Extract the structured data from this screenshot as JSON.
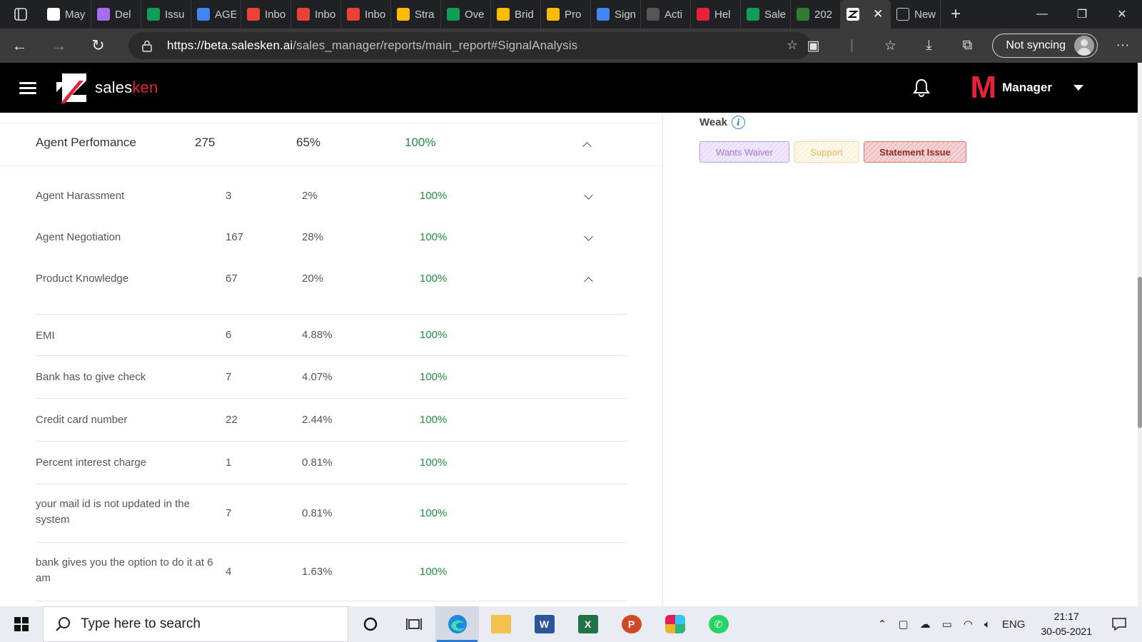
{
  "browser": {
    "tabs": [
      {
        "title": "May",
        "icon": "maps-pin-icon",
        "color": "#ffffff"
      },
      {
        "title": "Del",
        "icon": "app-icon",
        "color": "#a76cf0"
      },
      {
        "title": "Issu",
        "icon": "sheets-icon",
        "color": "#0f9d58"
      },
      {
        "title": "AGE",
        "icon": "docs-icon",
        "color": "#4285f4"
      },
      {
        "title": "Inbo",
        "icon": "gmail-icon",
        "color": "#ea4335"
      },
      {
        "title": "Inbo",
        "icon": "gmail-icon",
        "color": "#ea4335"
      },
      {
        "title": "Inbo",
        "icon": "gmail-icon",
        "color": "#ea4335"
      },
      {
        "title": "Stra",
        "icon": "drive-icon",
        "color": "#fbbc04"
      },
      {
        "title": "Ove",
        "icon": "sheets-icon",
        "color": "#0f9d58"
      },
      {
        "title": "Brid",
        "icon": "drive-icon",
        "color": "#fbbc04"
      },
      {
        "title": "Pro",
        "icon": "drive-icon",
        "color": "#fbbc04"
      },
      {
        "title": "Sign",
        "icon": "docs-icon",
        "color": "#4285f4"
      },
      {
        "title": "Acti",
        "icon": "salesken-icon",
        "color": "#555555"
      },
      {
        "title": "Hel",
        "icon": "salesken-red-icon",
        "color": "#e8213a"
      },
      {
        "title": "Sale",
        "icon": "sheets-icon",
        "color": "#0f9d58"
      },
      {
        "title": "202",
        "icon": "leaf-icon",
        "color": "#2e7d32"
      }
    ],
    "active_tab": {
      "title": "",
      "close": "✕"
    },
    "new_tab": {
      "title": "New"
    },
    "url_host": "https://beta.salesken.ai",
    "url_path": "/sales_manager/reports/main_report#SignalAnalysis",
    "sync_label": "Not syncing"
  },
  "app": {
    "brand_prefix": "sales",
    "brand_suffix": "ken",
    "brand_color": "#e8213a",
    "user_initial": "M",
    "user_role": "Manager"
  },
  "report": {
    "group": {
      "name": "Agent Perfomance",
      "count": "275",
      "share": "65%",
      "accuracy": "100%",
      "expanded": true
    },
    "categories": [
      {
        "name": "Agent Harassment",
        "count": "3",
        "share": "2%",
        "accuracy": "100%",
        "expanded": false
      },
      {
        "name": "Agent Negotiation",
        "count": "167",
        "share": "28%",
        "accuracy": "100%",
        "expanded": false
      },
      {
        "name": "Product Knowledge",
        "count": "67",
        "share": "20%",
        "accuracy": "100%",
        "expanded": true
      }
    ],
    "signals": [
      {
        "name": "EMI",
        "count": "6",
        "share": "4.88%",
        "accuracy": "100%"
      },
      {
        "name": "Bank has to give check",
        "count": "7",
        "share": "4.07%",
        "accuracy": "100%"
      },
      {
        "name": "Credit card number",
        "count": "22",
        "share": "2.44%",
        "accuracy": "100%"
      },
      {
        "name": "Percent interest charge",
        "count": "1",
        "share": "0.81%",
        "accuracy": "100%"
      },
      {
        "name": "your mail id is not updated in the system",
        "count": "7",
        "share": "0.81%",
        "accuracy": "100%"
      },
      {
        "name": "bank gives you the option to do it at 6 am",
        "count": "4",
        "share": "1.63%",
        "accuracy": "100%"
      }
    ],
    "weak": {
      "title": "Weak",
      "tags": [
        "Wants Waiver",
        "Support",
        "Statement Issue"
      ]
    }
  },
  "taskbar": {
    "search_placeholder": "Type here to search",
    "language": "ENG",
    "time": "21:17",
    "date": "30-05-2021"
  }
}
